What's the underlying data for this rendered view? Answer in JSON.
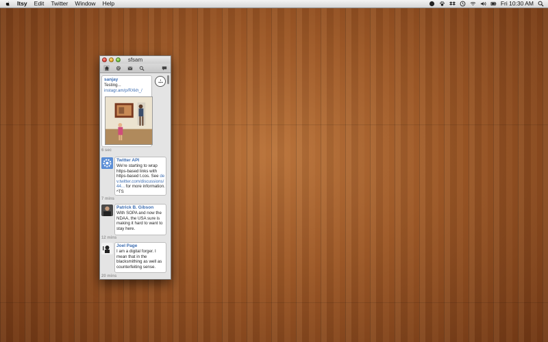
{
  "menubar": {
    "app_name": "Itsy",
    "menus": [
      "Edit",
      "Twitter",
      "Window",
      "Help"
    ],
    "clock": "Fri 10:30 AM"
  },
  "window": {
    "title": "sfsam"
  },
  "tweets": [
    {
      "user": "sanjay",
      "text": "Testing...",
      "link": "instagr.am/p/RXkh_/",
      "time": "6 sec"
    },
    {
      "user": "Twitter API",
      "text_before_link": "We're starting to wrap https-based links with https-based t.cos. See",
      "link": "dev.twitter.com/discussions/44...",
      "text_after_link": "for more information. ^TS",
      "time": "7 mins"
    },
    {
      "user": "Patrick B. Gibson",
      "text": "With SOPA and now the NDAA, the USA sure is making it hard to want to stay here.",
      "time": "12 mins"
    },
    {
      "user": "Joel Page",
      "text": "I am a digital forger. I mean that in the blacksmithing as well as counterfeiting sense.",
      "time": "20 mins"
    }
  ],
  "colors": {
    "link": "#3a6bb0",
    "desktop_wood": "#9a5626"
  }
}
